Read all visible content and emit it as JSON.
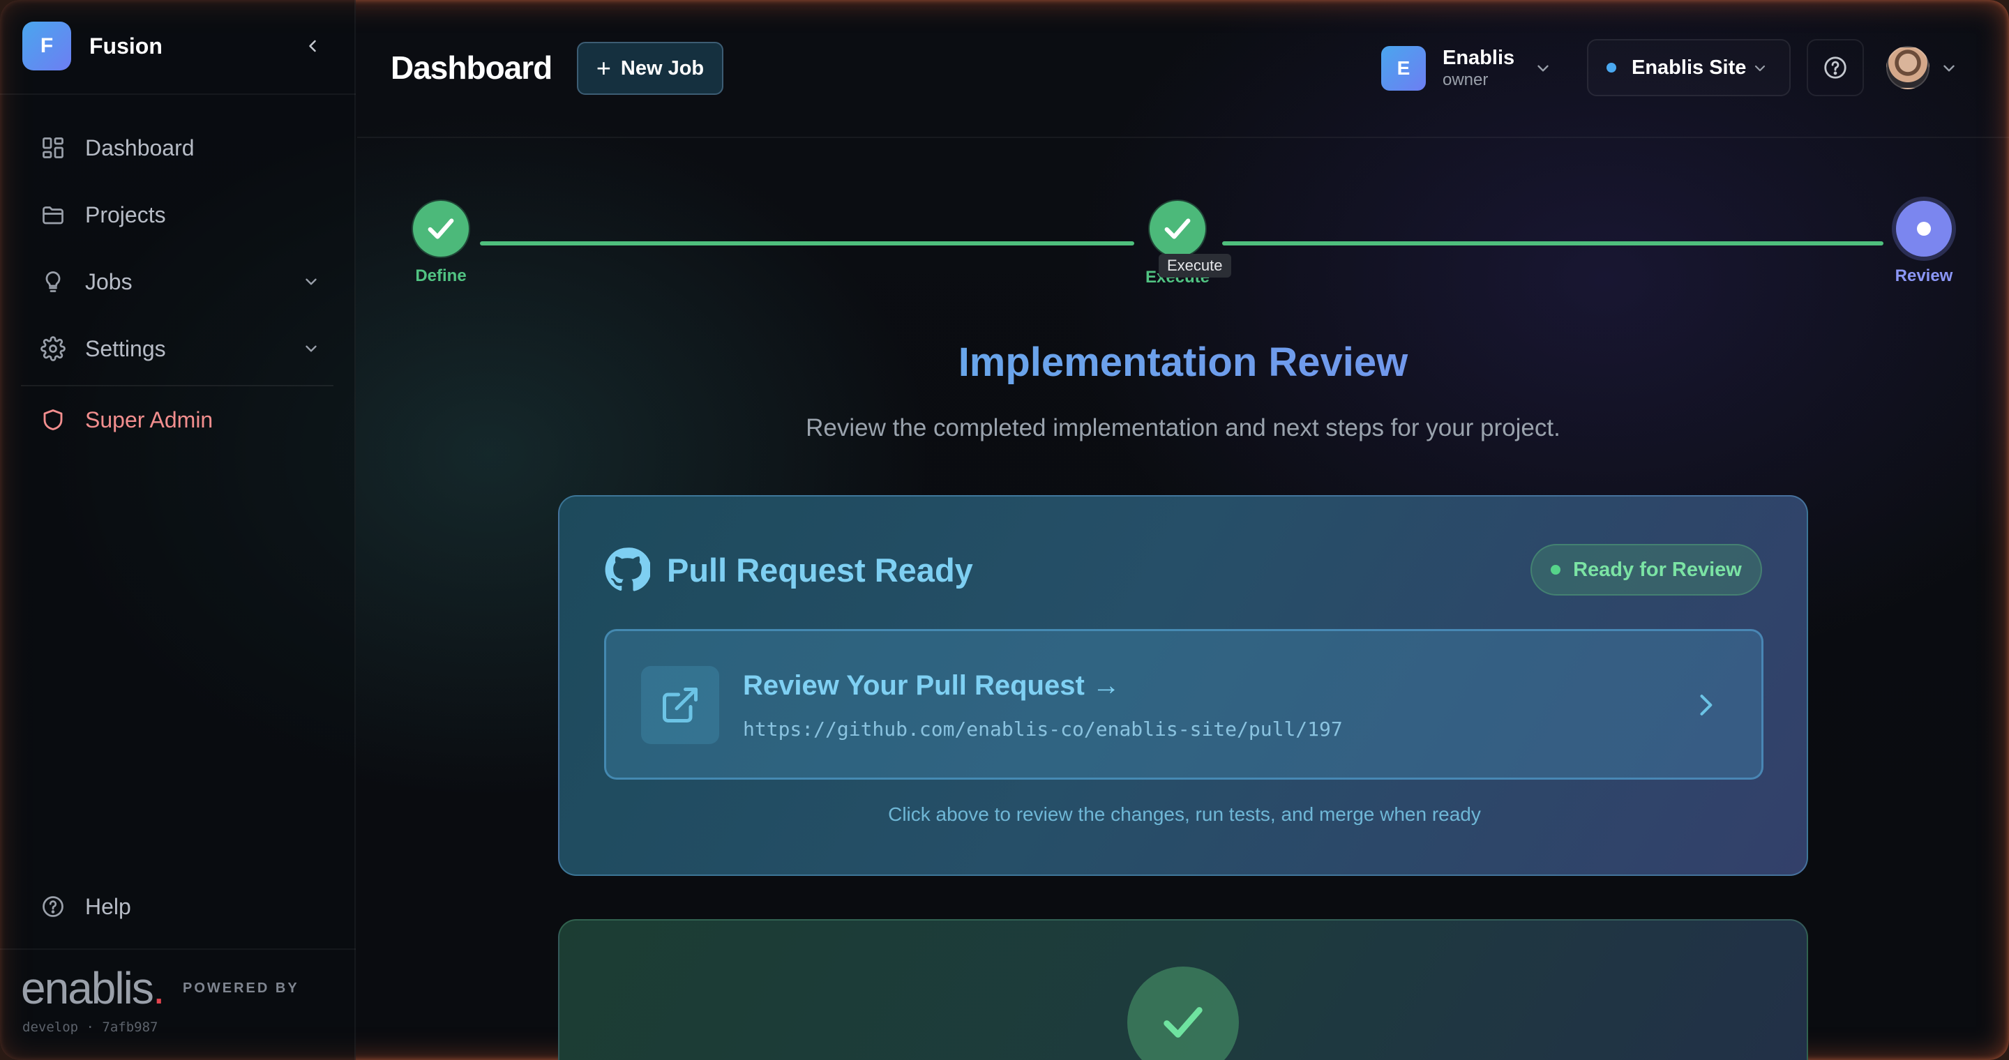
{
  "app": {
    "brand_initial": "F",
    "brand_name": "Fusion"
  },
  "sidebar": {
    "items": [
      {
        "label": "Dashboard",
        "icon": "grid-icon"
      },
      {
        "label": "Projects",
        "icon": "folder-icon"
      },
      {
        "label": "Jobs",
        "icon": "lightbulb-icon",
        "expandable": true
      },
      {
        "label": "Settings",
        "icon": "gear-icon",
        "expandable": true
      },
      {
        "label": "Super Admin",
        "icon": "shield-icon"
      }
    ],
    "help_label": "Help",
    "footer_logo": "enablis",
    "footer_logo_dot": ".",
    "powered_by": "POWERED BY",
    "build": "develop · 7afb987"
  },
  "header": {
    "title": "Dashboard",
    "new_job_label": "New Job",
    "org": {
      "initial": "E",
      "name": "Enablis",
      "role": "owner"
    },
    "site": "Enablis Site"
  },
  "stepper": {
    "steps": [
      {
        "label": "Define",
        "state": "done"
      },
      {
        "label": "Execute",
        "state": "done"
      },
      {
        "label": "Review",
        "state": "current"
      }
    ],
    "tooltip": "Execute"
  },
  "review": {
    "title": "Implementation Review",
    "subtitle": "Review the completed implementation and next steps for your project."
  },
  "pr_card": {
    "title": "Pull Request Ready",
    "badge": "Ready for Review",
    "link_title": "Review Your Pull Request →",
    "link_url": "https://github.com/enablis-co/enablis-site/pull/197",
    "note": "Click above to review the changes, run tests, and merge when ready"
  },
  "colors": {
    "accent_green": "#4cb97a",
    "accent_purple": "#7b86ef",
    "admin_red": "#f28e8e",
    "link_blue": "#7fd0f3"
  }
}
